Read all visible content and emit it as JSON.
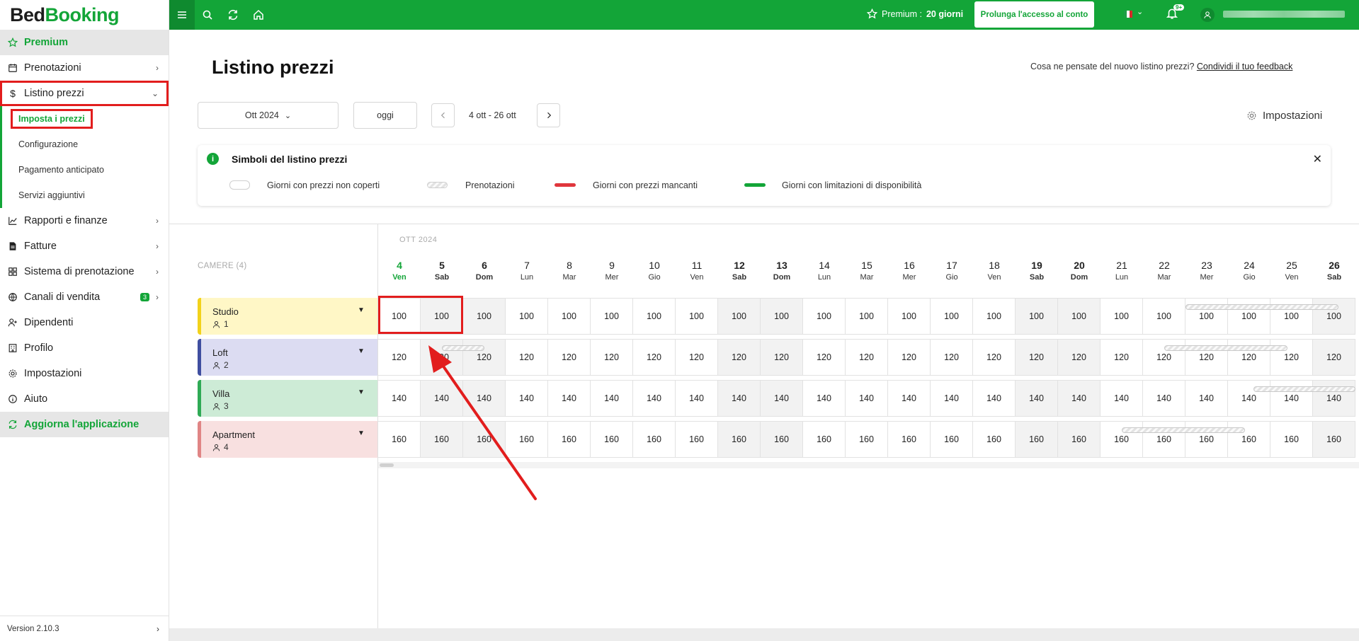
{
  "logo": {
    "part1": "Bed",
    "part2": "Booking"
  },
  "sidebar": {
    "premium": "Premium",
    "items": [
      {
        "label": "Prenotazioni"
      },
      {
        "label": "Listino prezzi"
      },
      {
        "label": "Rapporti e finanze"
      },
      {
        "label": "Fatture"
      },
      {
        "label": "Sistema di prenotazione"
      },
      {
        "label": "Canali di vendita",
        "badge": "3"
      },
      {
        "label": "Dipendenti"
      },
      {
        "label": "Profilo"
      },
      {
        "label": "Impostazioni"
      },
      {
        "label": "Aiuto"
      }
    ],
    "subitems": [
      "Imposta i prezzi",
      "Configurazione",
      "Pagamento anticipato",
      "Servizi aggiuntivi"
    ],
    "update": "Aggiorna l'applicazione",
    "version": "Version 2.10.3"
  },
  "topbar": {
    "premium_label": "Premium :",
    "premium_days": "20 giorni",
    "extend_button": "Prolunga l'accesso al conto",
    "notif_badge": "9+"
  },
  "main": {
    "title": "Listino prezzi",
    "feedback_text": "Cosa ne pensate del nuovo listino prezzi?",
    "feedback_link": "Condividi il tuo feedback",
    "month": "Ott 2024",
    "today": "oggi",
    "range": "4 ott - 26 ott",
    "settings": "Impostazioni"
  },
  "legend": {
    "title": "Simboli del listino prezzi",
    "items": [
      "Giorni con prezzi non coperti",
      "Prenotazioni",
      "Giorni con prezzi mancanti",
      "Giorni con limitazioni di disponibilità"
    ],
    "colors": {
      "missing": "#e0363c",
      "limits": "#13a538"
    }
  },
  "grid": {
    "rooms_header": "CAMERE (4)",
    "month_label": "OTT 2024",
    "days": [
      {
        "n": "4",
        "w": "Ven",
        "we": false,
        "today": true
      },
      {
        "n": "5",
        "w": "Sab",
        "we": true
      },
      {
        "n": "6",
        "w": "Dom",
        "we": true
      },
      {
        "n": "7",
        "w": "Lun"
      },
      {
        "n": "8",
        "w": "Mar"
      },
      {
        "n": "9",
        "w": "Mer"
      },
      {
        "n": "10",
        "w": "Gio"
      },
      {
        "n": "11",
        "w": "Ven"
      },
      {
        "n": "12",
        "w": "Sab",
        "we": true
      },
      {
        "n": "13",
        "w": "Dom",
        "we": true
      },
      {
        "n": "14",
        "w": "Lun"
      },
      {
        "n": "15",
        "w": "Mar"
      },
      {
        "n": "16",
        "w": "Mer"
      },
      {
        "n": "17",
        "w": "Gio"
      },
      {
        "n": "18",
        "w": "Ven"
      },
      {
        "n": "19",
        "w": "Sab",
        "we": true
      },
      {
        "n": "20",
        "w": "Dom",
        "we": true
      },
      {
        "n": "21",
        "w": "Lun"
      },
      {
        "n": "22",
        "w": "Mar"
      },
      {
        "n": "23",
        "w": "Mer"
      },
      {
        "n": "24",
        "w": "Gio"
      },
      {
        "n": "25",
        "w": "Ven"
      },
      {
        "n": "26",
        "w": "Sab",
        "we": true
      }
    ],
    "rooms": [
      {
        "name": "Studio",
        "cap": "1",
        "color": "#fff7c6",
        "bar": "#f2d21b",
        "price": "100"
      },
      {
        "name": "Loft",
        "cap": "2",
        "color": "#dcdcf2",
        "bar": "#3f4ea0",
        "price": "120"
      },
      {
        "name": "Villa",
        "cap": "3",
        "color": "#cdebd6",
        "bar": "#2faa55",
        "price": "140"
      },
      {
        "name": "Apartment",
        "cap": "4",
        "color": "#f8e0e0",
        "bar": "#e08585",
        "price": "160"
      }
    ]
  }
}
